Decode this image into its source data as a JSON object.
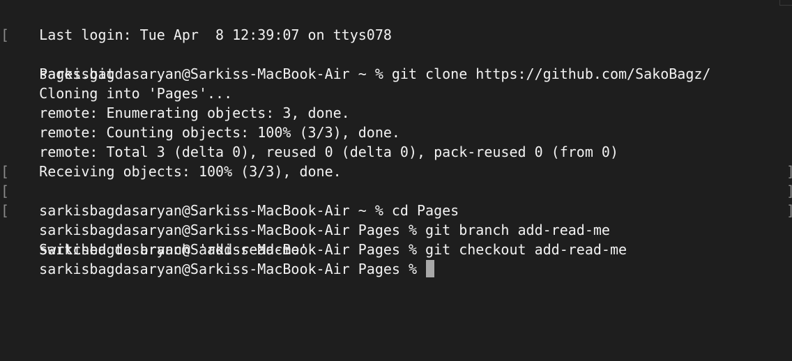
{
  "terminal": {
    "lines": [
      {
        "text": "Last login: Tue Apr  8 12:39:07 on ttys078",
        "mark_left": "",
        "mark_right": ""
      },
      {
        "text": "sarkisbagdasaryan@Sarkiss-MacBook-Air ~ % git clone https://github.com/SakoBagz/",
        "mark_left": "[",
        "mark_right": ""
      },
      {
        "text": "Pages.git",
        "mark_left": "",
        "mark_right": ""
      },
      {
        "text": "Cloning into 'Pages'...",
        "mark_left": "",
        "mark_right": ""
      },
      {
        "text": "remote: Enumerating objects: 3, done.",
        "mark_left": "",
        "mark_right": ""
      },
      {
        "text": "remote: Counting objects: 100% (3/3), done.",
        "mark_left": "",
        "mark_right": ""
      },
      {
        "text": "remote: Total 3 (delta 0), reused 0 (delta 0), pack-reused 0 (from 0)",
        "mark_left": "",
        "mark_right": ""
      },
      {
        "text": "Receiving objects: 100% (3/3), done.",
        "mark_left": "",
        "mark_right": ""
      },
      {
        "text": "sarkisbagdasaryan@Sarkiss-MacBook-Air ~ % cd Pages",
        "mark_left": "[",
        "mark_right": "]"
      },
      {
        "text": "sarkisbagdasaryan@Sarkiss-MacBook-Air Pages % git branch add-read-me",
        "mark_left": "[",
        "mark_right": "]"
      },
      {
        "text": "sarkisbagdasaryan@Sarkiss-MacBook-Air Pages % git checkout add-read-me",
        "mark_left": "[",
        "mark_right": "]"
      },
      {
        "text": "Switched to branch 'add-read-me'",
        "mark_left": "",
        "mark_right": ""
      },
      {
        "text": "sarkisbagdasaryan@Sarkiss-MacBook-Air Pages % ",
        "mark_left": "",
        "mark_right": ""
      }
    ]
  },
  "colors": {
    "background": "#1e1e1e",
    "text": "#f2f2f2",
    "cursor": "#a8a8a8",
    "marks": "#8a8a8a"
  }
}
